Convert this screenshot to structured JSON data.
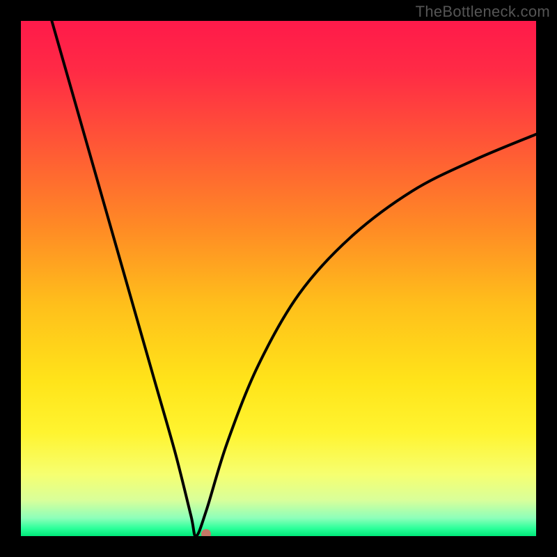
{
  "watermark": "TheBottleneck.com",
  "colors": {
    "bg": "#000000",
    "curve": "#000000",
    "marker": "#c57867",
    "gradient_stops": [
      {
        "offset": 0.0,
        "color": "#ff1a4a"
      },
      {
        "offset": 0.1,
        "color": "#ff2b45"
      },
      {
        "offset": 0.25,
        "color": "#ff5a35"
      },
      {
        "offset": 0.4,
        "color": "#ff8a25"
      },
      {
        "offset": 0.55,
        "color": "#ffbf1b"
      },
      {
        "offset": 0.7,
        "color": "#ffe41a"
      },
      {
        "offset": 0.8,
        "color": "#fff430"
      },
      {
        "offset": 0.88,
        "color": "#f6ff70"
      },
      {
        "offset": 0.93,
        "color": "#d9ff9a"
      },
      {
        "offset": 0.965,
        "color": "#8dffba"
      },
      {
        "offset": 0.985,
        "color": "#2bff9a"
      },
      {
        "offset": 1.0,
        "color": "#00e879"
      }
    ]
  },
  "chart_data": {
    "type": "line",
    "title": "",
    "xlabel": "",
    "ylabel": "",
    "xlim": [
      0,
      1
    ],
    "ylim": [
      0,
      1
    ],
    "minimum": {
      "x": 0.34,
      "y": 0.0
    },
    "marker_point": {
      "x": 0.36,
      "y": 0.0
    },
    "series": [
      {
        "name": "left-branch",
        "x": [
          0.06,
          0.1,
          0.14,
          0.18,
          0.22,
          0.26,
          0.3,
          0.33,
          0.34
        ],
        "y": [
          1.0,
          0.86,
          0.72,
          0.58,
          0.44,
          0.3,
          0.16,
          0.04,
          0.0
        ]
      },
      {
        "name": "right-branch",
        "x": [
          0.34,
          0.36,
          0.4,
          0.46,
          0.54,
          0.64,
          0.76,
          0.88,
          1.0
        ],
        "y": [
          0.0,
          0.05,
          0.18,
          0.33,
          0.47,
          0.58,
          0.67,
          0.73,
          0.78
        ]
      }
    ]
  }
}
